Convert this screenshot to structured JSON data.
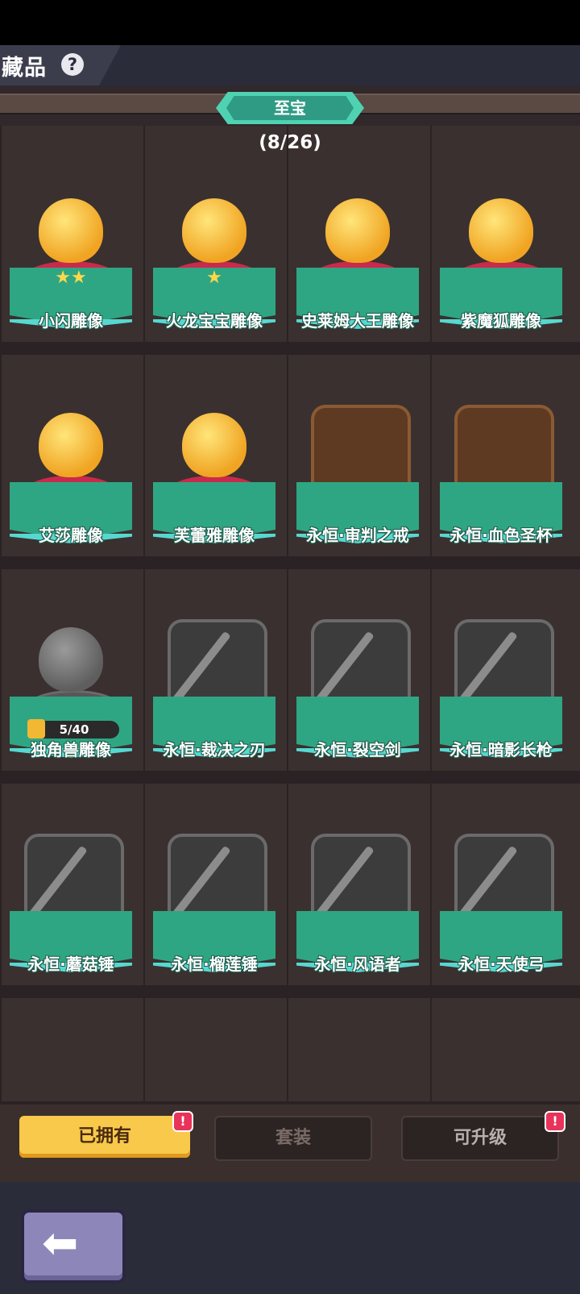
{
  "header": {
    "title": "藏品",
    "help_icon": "question-icon"
  },
  "category": {
    "name": "至宝",
    "count": "(8/26)"
  },
  "items": [
    {
      "name": "小闪雕像",
      "stars": "★★",
      "style": "gold"
    },
    {
      "name": "火龙宝宝雕像",
      "stars": "★",
      "style": "gold"
    },
    {
      "name": "史莱姆大王雕像",
      "stars": "",
      "style": "gold"
    },
    {
      "name": "紫魔狐雕像",
      "stars": "",
      "style": "gold"
    },
    {
      "name": "艾莎雕像",
      "stars": "",
      "style": "gold"
    },
    {
      "name": "芙蕾雅雕像",
      "stars": "",
      "style": "gold"
    },
    {
      "name": "永恒·审判之戒",
      "stars": "",
      "style": "case"
    },
    {
      "name": "永恒·血色圣杯",
      "stars": "",
      "style": "case"
    },
    {
      "name": "独角兽雕像",
      "progress": "5/40",
      "style": "locked"
    },
    {
      "name": "永恒·裁决之刃",
      "style": "locked-case"
    },
    {
      "name": "永恒·裂空剑",
      "style": "locked-case"
    },
    {
      "name": "永恒·暗影长枪",
      "style": "locked-case"
    },
    {
      "name": "永恒·蘑菇锤",
      "style": "locked-case"
    },
    {
      "name": "永恒·榴莲锤",
      "style": "locked-case"
    },
    {
      "name": "永恒·风语者",
      "style": "locked-case"
    },
    {
      "name": "永恒·天使弓",
      "style": "locked-case"
    }
  ],
  "tabs": {
    "owned": "已拥有",
    "sets": "套装",
    "upgradable": "可升级"
  },
  "badge": "!",
  "colors": {
    "plate": "#2fa683",
    "accent": "#f8c94a",
    "badge": "#e8335a"
  }
}
